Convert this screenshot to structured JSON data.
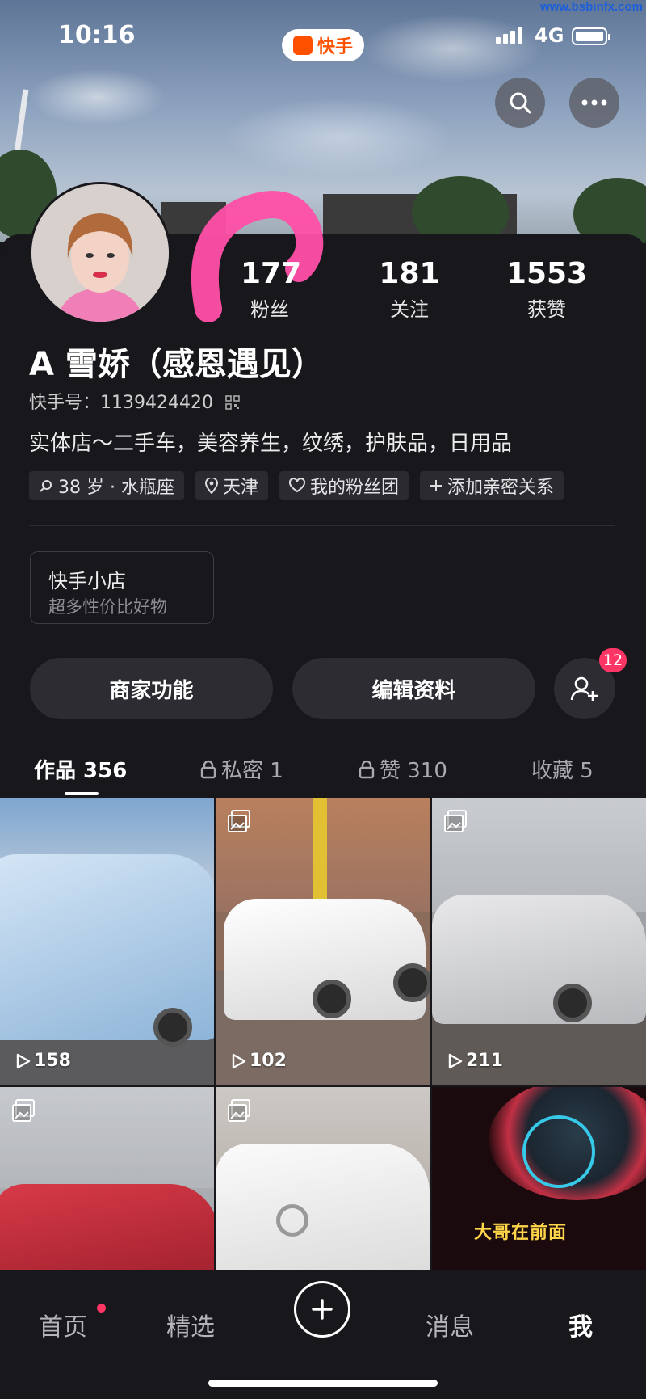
{
  "status_bar": {
    "time": "10:16",
    "network": "4G"
  },
  "app_badge": {
    "label": "快手"
  },
  "watermark": "www.bsbinfx.com",
  "profile": {
    "stats": [
      {
        "value": "177",
        "label": "粉丝"
      },
      {
        "value": "181",
        "label": "关注"
      },
      {
        "value": "1553",
        "label": "获赞"
      }
    ],
    "name": "A 雪娇（感恩遇见）",
    "kuaishou_id": "快手号：1139424420",
    "bio": "实体店～二手车，美容养生，纹绣，护肤品，日用品",
    "tags": [
      "38 岁 · 水瓶座",
      "天津",
      "我的粉丝团",
      "添加亲密关系"
    ]
  },
  "shop": {
    "title": "快手小店",
    "subtitle": "超多性价比好物"
  },
  "actions": {
    "merchant": "商家功能",
    "edit": "编辑资料",
    "friend_badge": "12"
  },
  "tabs": [
    {
      "label": "作品 356"
    },
    {
      "label": "私密 1"
    },
    {
      "label": "赞 310"
    },
    {
      "label": "收藏 5"
    }
  ],
  "grid": [
    {
      "plays": "158"
    },
    {
      "plays": "102"
    },
    {
      "plays": "211"
    },
    {
      "plays": ""
    },
    {
      "plays": ""
    },
    {
      "caption": "大哥在前面"
    }
  ],
  "bottom_nav": {
    "home": "首页",
    "featured": "精选",
    "messages": "消息",
    "me": "我"
  },
  "colors": {
    "accent": "#ff5000",
    "badge": "#fe3666",
    "background": "#17171c"
  }
}
